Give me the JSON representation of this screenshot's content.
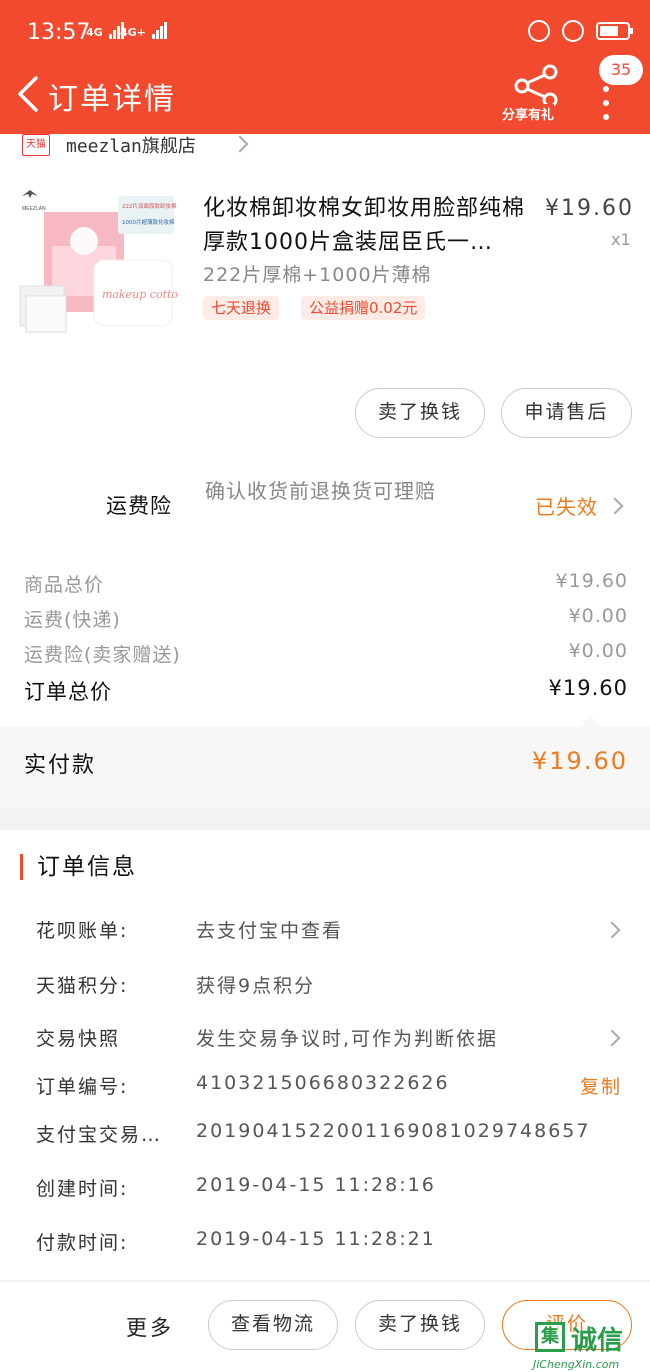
{
  "status_bar": {
    "time": "13:57",
    "signal1": "4G",
    "signal2": "4G+"
  },
  "nav": {
    "title": "订单详情",
    "share_label": "分享有礼",
    "badge_count": "35"
  },
  "shop": {
    "badge": "天猫",
    "name": "meezlan旗舰店"
  },
  "product": {
    "title": "化妆棉卸妆棉女卸妆用脸部纯棉厚款1000片盒装屈臣氏一…",
    "price": "¥19.60",
    "qty": "x1",
    "spec": "222片厚棉+1000片薄棉",
    "tags": [
      "七天退换",
      "公益捐赠0.02元"
    ],
    "image": {
      "brand": "MEEZLAN",
      "box_text_1": "222片双面厚款卸妆棉",
      "box_text_2": "1000片超薄款化妆棉",
      "box_label": "makeup cotton"
    },
    "buttons": {
      "resell": "卖了换钱",
      "after_sale": "申请售后"
    }
  },
  "insurance": {
    "label": "运费险",
    "desc": "确认收货前退换货可理赔",
    "status": "已失效"
  },
  "fees": [
    {
      "label": "商品总价",
      "value": "¥19.60"
    },
    {
      "label": "运费(快递)",
      "value": "¥0.00"
    },
    {
      "label": "运费险(卖家赠送)",
      "value": "¥0.00"
    }
  ],
  "order_total": {
    "label": "订单总价",
    "value": "¥19.60"
  },
  "paid": {
    "label": "实付款",
    "value": "¥19.60"
  },
  "order_info": {
    "heading": "订单信息",
    "rows": [
      {
        "key": "花呗账单:",
        "value": "去支付宝中查看"
      },
      {
        "key": "天猫积分:",
        "value": "获得9点积分"
      },
      {
        "key": "交易快照",
        "value": "发生交易争议时,可作为判断依据"
      },
      {
        "key": "订单编号:",
        "value": "410321506680322626",
        "action": "复制"
      },
      {
        "key": "支付宝交易…",
        "value": "2019041522001169081029748657"
      },
      {
        "key": "创建时间:",
        "value": "2019-04-15 11:28:16"
      },
      {
        "key": "付款时间:",
        "value": "2019-04-15 11:28:21"
      }
    ]
  },
  "bottom": {
    "more": "更多",
    "logistics": "查看物流",
    "resell": "卖了换钱",
    "evaluate": "评价"
  },
  "watermark": {
    "char": "集",
    "text": "诚信",
    "url": "JiChengXin.com"
  }
}
